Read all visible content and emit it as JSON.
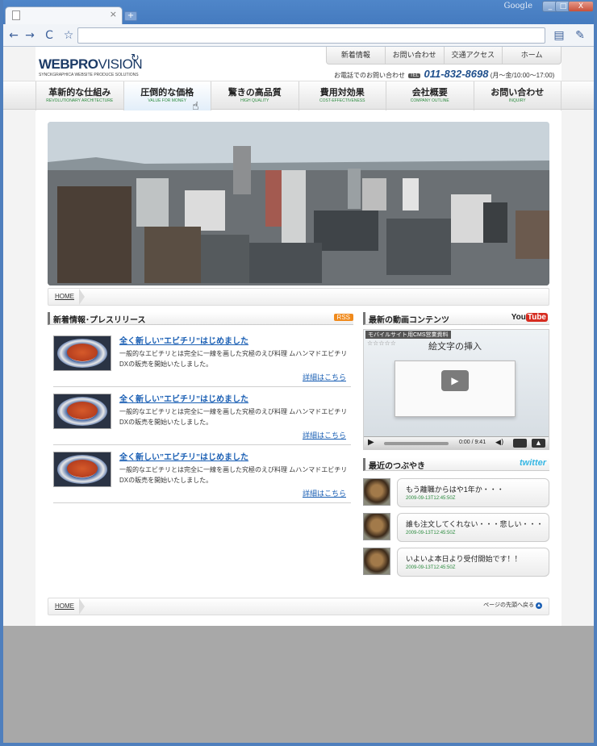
{
  "browser": {
    "brand": "Google",
    "tab_close": "×",
    "new_tab": "+",
    "window_buttons": [
      "_",
      "□",
      "X"
    ],
    "nav": {
      "back": "←",
      "forward": "→",
      "reload": "C",
      "star": "☆",
      "go": "▶",
      "page": "▤",
      "wrench": "✎"
    }
  },
  "site": {
    "logo_main_bold": "WEB",
    "logo_main_pro": "PRO",
    "logo_main_rest": "VISION",
    "logo_sub": "SYNCKGRAPHICA WEBSITE PRODUCE SOLUTIONS",
    "top_nav": [
      "新着情報",
      "お問い合わせ",
      "交通アクセス",
      "ホーム"
    ],
    "phone_label": "お電話でのお問い合わせ",
    "tel_badge": "TEL",
    "phone_number": "011-832-8698",
    "phone_hours": "(月～金/10:00～17:00)",
    "main_nav": [
      {
        "ja": "革新的な仕組み",
        "en": "REVOLUTIONARY ARCHITECTURE"
      },
      {
        "ja": "圧倒的な価格",
        "en": "VALUE FOR MONEY"
      },
      {
        "ja": "驚きの高品質",
        "en": "HIGH QUALITY"
      },
      {
        "ja": "費用対効果",
        "en": "COST-EFFECTIVENESS"
      },
      {
        "ja": "会社概要",
        "en": "COMPANY OUTLINE"
      },
      {
        "ja": "お問い合わせ",
        "en": "INQUIRY"
      }
    ],
    "breadcrumb_home": "HOME",
    "news_heading": "新着情報･プレスリリース",
    "rss_label": "RSS",
    "news": [
      {
        "title": "全く新しい”エビチリ”はじめました",
        "body": "一般的なエビチリとは完全に一線を画した究極のえび料理 ムハンマドエビチリDXの販売を開始いたしました。",
        "more": "詳細はこちら"
      },
      {
        "title": "全く新しい”エビチリ”はじめました",
        "body": "一般的なエビチリとは完全に一線を画した究極のえび料理 ムハンマドエビチリDXの販売を開始いたしました。",
        "more": "詳細はこちら"
      },
      {
        "title": "全く新しい”エビチリ”はじめました",
        "body": "一般的なエビチリとは完全に一線を画した究極のえび料理 ムハンマドエビチリDXの販売を開始いたしました。",
        "more": "詳細はこちら"
      }
    ],
    "video_heading": "最新の動画コンテンツ",
    "youtube_a": "You",
    "youtube_b": "Tube",
    "video_label": "モバイルサイト用CMS営業資料",
    "video_stars": "☆☆☆☆☆",
    "video_title": "絵文字の挿入",
    "video_time": "0:00 / 9:41",
    "tweets_heading": "最近のつぶやき",
    "twitter_label": "twitter",
    "tweets": [
      {
        "text": "もう離職からはや1年か・・・",
        "ts": "2009-09-13T12:45:50Z"
      },
      {
        "text": "誰も注文してくれない・・・悲しい・・・",
        "ts": "2009-09-13T12:45:50Z"
      },
      {
        "text": "いよいよ本日より受付開始です！！",
        "ts": "2009-09-13T12:45:50Z"
      }
    ],
    "go_top": "ページの先頭へ戻る"
  },
  "colors": {
    "link": "#1a5fb4",
    "accent_green": "#2b8a3e",
    "phone_blue": "#1f4f8c"
  }
}
